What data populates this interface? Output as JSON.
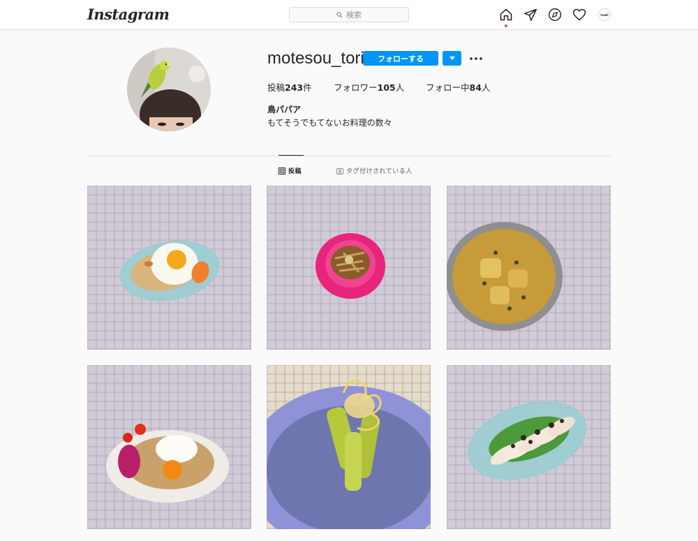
{
  "app": {
    "logo": "Instagram"
  },
  "search": {
    "placeholder": "検索"
  },
  "nav": {
    "icons": [
      "home-icon",
      "direct-icon",
      "explore-icon",
      "activity-icon",
      "profile-avatar"
    ],
    "avatar_text": "tsuki"
  },
  "profile": {
    "username": "motesou_tori",
    "follow_label": "フォローする",
    "stats": [
      {
        "label": "投稿",
        "value": "243",
        "unit": "件"
      },
      {
        "label": "フォロワー",
        "value": "105",
        "unit": "人"
      },
      {
        "label": "フォロー中",
        "value": "84",
        "unit": "人"
      }
    ],
    "full_name": "鳥パパア",
    "bio": "もてそうでもてないお料理の数々"
  },
  "tabs": [
    {
      "label": "投稿",
      "icon": "grid-icon",
      "active": true
    },
    {
      "label": "タグ付けされている人",
      "icon": "tagged-icon",
      "active": false
    }
  ],
  "colors": {
    "accent": "#0095f6",
    "notification": "#ed4956",
    "tile_background": "#cac4d1"
  },
  "posts": [
    {
      "icon": "fried-egg-rice-plate"
    },
    {
      "icon": "burdock-pink-plate"
    },
    {
      "icon": "curry-bowl"
    },
    {
      "icon": "soboro-rice-egg-plate"
    },
    {
      "icon": "crispy-vegetable-blue-plate"
    },
    {
      "icon": "sliced-chicken-plate"
    }
  ]
}
